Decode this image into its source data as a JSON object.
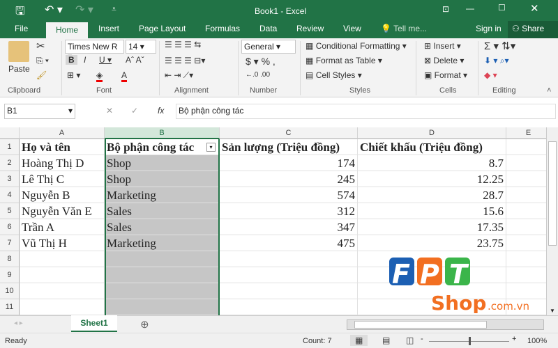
{
  "window": {
    "title": "Book1 - Excel"
  },
  "menu": {
    "tabs": [
      "File",
      "Home",
      "Insert",
      "Page Layout",
      "Formulas",
      "Data",
      "Review",
      "View"
    ],
    "tell_me": "Tell me...",
    "sign_in": "Sign in",
    "share": "Share"
  },
  "ribbon": {
    "paste": "Paste",
    "font_name": "Times New R",
    "font_size": "14",
    "number_format": "General",
    "conditional_formatting": "Conditional Formatting",
    "format_as_table": "Format as Table",
    "cell_styles": "Cell Styles",
    "insert": "Insert",
    "delete": "Delete",
    "format": "Format",
    "groups": [
      "Clipboard",
      "Font",
      "Alignment",
      "Number",
      "Styles",
      "Cells",
      "Editing"
    ]
  },
  "formula_bar": {
    "name_box": "B1",
    "fx": "fx",
    "content": "Bộ phận công tác"
  },
  "sheet": {
    "columns": [
      "A",
      "B",
      "C",
      "D",
      "E"
    ],
    "row_numbers": [
      "1",
      "2",
      "3",
      "4",
      "5",
      "6",
      "7",
      "8",
      "9",
      "10",
      "11"
    ],
    "header": [
      "Họ và tên",
      "Bộ phận công tác",
      "Sản lượng (Triệu đồng)",
      "Chiết khấu (Triệu đồng)"
    ],
    "rows": [
      [
        "Hoàng Thị D",
        "Shop",
        "174",
        "8.7"
      ],
      [
        "Lê Thị C",
        "Shop",
        "245",
        "12.25"
      ],
      [
        "Nguyễn B",
        "Marketing",
        "574",
        "28.7"
      ],
      [
        "Nguyễn Văn E",
        "Sales",
        "312",
        "15.6"
      ],
      [
        "Trần A",
        "Sales",
        "347",
        "17.35"
      ],
      [
        "Vũ Thị H",
        "Marketing",
        "475",
        "23.75"
      ]
    ]
  },
  "watermark": {
    "logo": "FPT",
    "sub": "Shop",
    "domain": ".com.vn"
  },
  "sheet_tabs": {
    "active": "Sheet1"
  },
  "status": {
    "ready": "Ready",
    "count": "Count: 7",
    "zoom": "100%"
  },
  "colors": {
    "excel_green": "#217346",
    "logo_blue": "#1c5fb3",
    "logo_orange": "#f26f21",
    "logo_green": "#3bb54a"
  }
}
